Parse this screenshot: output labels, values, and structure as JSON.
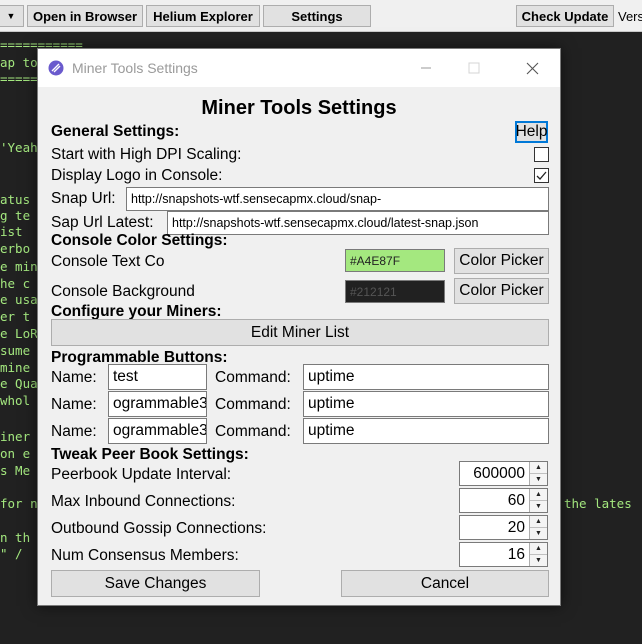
{
  "toolbar": {
    "open_browser": "Open in Browser",
    "helium_explorer": "Helium Explorer",
    "settings": "Settings",
    "check_update": "Check Update",
    "version_fragment": "Vers"
  },
  "console": {
    "lines": [
      "===========",
      "ap to",
      "=====",
      "'Yeah",
      "atus",
      "g te",
      "ist",
      "erbo",
      "e min",
      "he c",
      "e usa",
      "er t",
      "e LoR",
      "sume",
      "mine",
      "e Qua",
      "whol",
      "iner",
      "on e",
      "s Me",
      "for n",
      "the lates",
      "n th",
      "\" /"
    ]
  },
  "window": {
    "title": "Miner Tools Settings",
    "heading": "Miner Tools Settings"
  },
  "general": {
    "section_label": "General Settings:",
    "help_label": "Help",
    "high_dpi_label": "Start with High DPI Scaling:",
    "high_dpi_checked": false,
    "display_logo_label": "Display Logo in Console:",
    "display_logo_checked": true,
    "snap_url_label": "Snap Url:",
    "snap_url_value": "http://snapshots-wtf.sensecapmx.cloud/snap-",
    "sap_url_latest_label": "Sap Url Latest:",
    "sap_url_latest_value": "http://snapshots-wtf.sensecapmx.cloud/latest-snap.json"
  },
  "console_colors": {
    "section_label": "Console Color Settings:",
    "text_color_label": "Console Text Co",
    "text_color_value": "#A4E87F",
    "background_label": "Console Background",
    "background_value": "#212121",
    "picker_label": "Color Picker"
  },
  "miners": {
    "section_label": "Configure your Miners:",
    "edit_button": "Edit Miner List"
  },
  "programmable": {
    "section_label": "Programmable Buttons:",
    "name_label": "Name:",
    "command_label": "Command:",
    "rows": [
      {
        "name": "test",
        "command": "uptime"
      },
      {
        "name": "ogrammable3",
        "command": "uptime"
      },
      {
        "name": "ogrammable3",
        "command": "uptime"
      }
    ]
  },
  "peer_book": {
    "section_label": "Tweak Peer Book Settings:",
    "items": [
      {
        "label": "Peerbook Update Interval:",
        "value": "600000"
      },
      {
        "label": "Max Inbound Connections:",
        "value": "60"
      },
      {
        "label": "Outbound Gossip Connections:",
        "value": "20"
      },
      {
        "label": "Num Consensus Members:",
        "value": "16"
      }
    ]
  },
  "actions": {
    "save": "Save Changes",
    "cancel": "Cancel"
  },
  "colors": {
    "console_text": "#A4E87F",
    "console_background": "#212121",
    "dialog_background": "#f0f0f0",
    "focus_border": "#0078d7"
  }
}
